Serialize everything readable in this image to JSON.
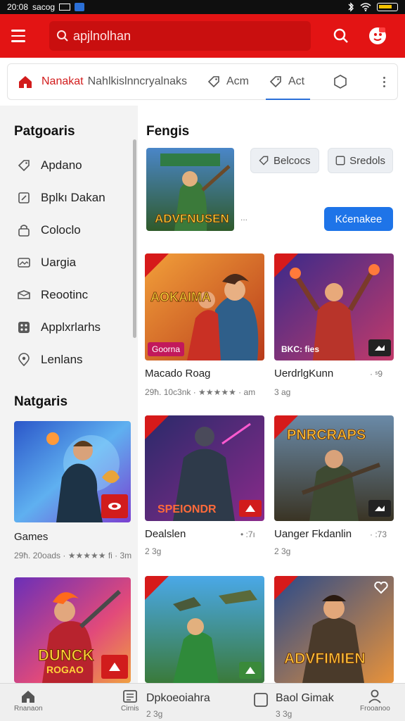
{
  "status_bar": {
    "time": "20:08",
    "carrier": "sacog"
  },
  "header": {
    "search_text": "apjlnolhan"
  },
  "nav": {
    "home_label": "Nanakat",
    "tab1": "Nahlkislnncryalnaks",
    "tab2": "Acm",
    "tab3": "Act"
  },
  "sidebar": {
    "heading": "Patgoaris",
    "items": [
      {
        "label": "Apdano",
        "icon": "tag-icon"
      },
      {
        "label": "Bplkı Dakan",
        "icon": "edit-box-icon"
      },
      {
        "label": "Coloclo",
        "icon": "lock-icon"
      },
      {
        "label": "Uargia",
        "icon": "image-icon"
      },
      {
        "label": "Reootinc",
        "icon": "mail-icon"
      },
      {
        "label": "Applxrlarhs",
        "icon": "apps-icon"
      },
      {
        "label": "Lenlans",
        "icon": "location-icon"
      }
    ],
    "heading2": "Natgaris",
    "card1": {
      "title": "Games",
      "meta": "29ħ. 20oads · ★★★★★ fi · 3m"
    },
    "card2": {}
  },
  "main": {
    "heading": "Fengis",
    "featured_dots": "...",
    "chip1": "Belcocs",
    "chip2": "Sredols",
    "primary_button": "Kćenakee",
    "cards": [
      {
        "title": "Macado Roag",
        "meta": "29ħ. 10c3nk · ★★★★★ · am",
        "side": "",
        "badge": "Goorna"
      },
      {
        "title": "UerdrlgKunn",
        "meta": "3 ag",
        "side": "· ˢ9",
        "badge": "BKC: fies"
      },
      {
        "title": "Dealslen",
        "meta": "2 3g",
        "side": "• :7ı",
        "badge": ""
      },
      {
        "title": "Uanger Fkdanlin",
        "meta": "2 3g",
        "side": "· :73",
        "badge": ""
      }
    ]
  },
  "bottom_nav": {
    "home": "Rnanaon",
    "mid1_icon_label": "Cirnis",
    "mid1_title": "Dpkoeoiahra",
    "mid1_sub": "2 3g",
    "mid2_title": "Baol Gimak",
    "mid2_sub": "3 3g",
    "profile": "Frooanoo"
  },
  "colors": {
    "brand_red": "#e31414",
    "accent_blue": "#1e74e8"
  }
}
